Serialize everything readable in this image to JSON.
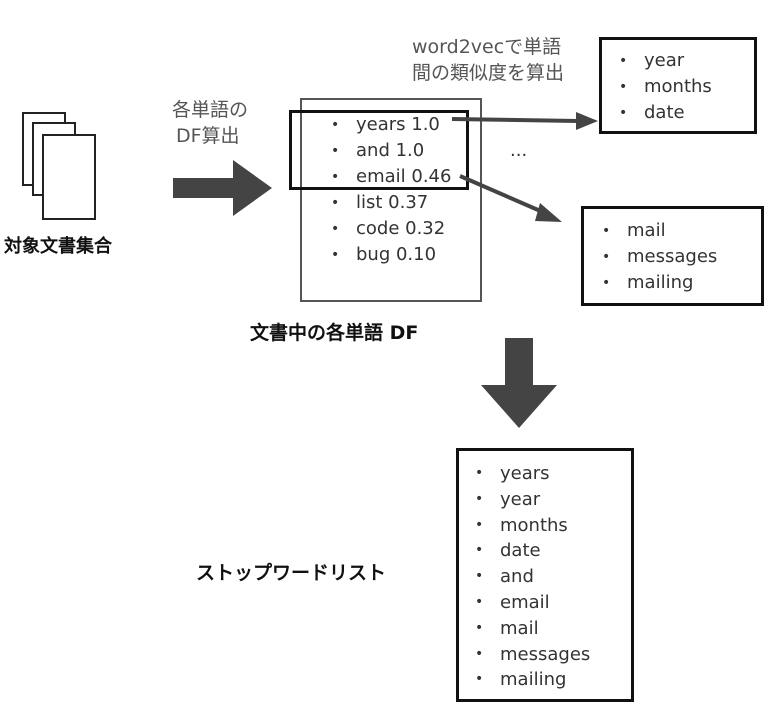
{
  "doc_set_label": "対象文書集合",
  "step1_label_line1": "各単語の",
  "step1_label_line2": "DF算出",
  "df_list_items": [
    "years 1.0",
    "and 1.0",
    "email 0.46",
    "list 0.37",
    "code 0.32",
    "bug 0.10"
  ],
  "df_panel_caption": "文書中の各単語 DF",
  "ellipsis": "...",
  "w2v_label_line1": "word2vecで単語",
  "w2v_label_line2": "間の類似度を算出",
  "similar_years": [
    "year",
    "months",
    "date"
  ],
  "similar_email": [
    "mail",
    "messages",
    "mailing"
  ],
  "stopword_label": "ストップワードリスト",
  "stopword_items": [
    "years",
    "year",
    "months",
    "date",
    "and",
    "email",
    "mail",
    "messages",
    "mailing"
  ],
  "colors": {
    "arrow": "#444444",
    "border": "#111111",
    "text": "#333333"
  }
}
